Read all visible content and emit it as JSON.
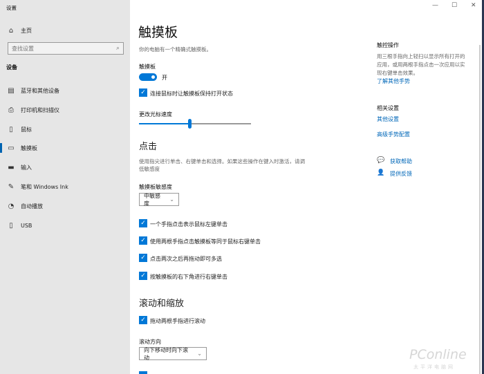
{
  "window": {
    "title": "设置",
    "minimize": "—",
    "maximize": "☐",
    "close": "✕"
  },
  "sidebar": {
    "home": "主页",
    "search_placeholder": "查找设置",
    "section": "设备",
    "items": [
      {
        "label": "蓝牙和其他设备",
        "icon": "bluetooth-devices-icon"
      },
      {
        "label": "打印机和扫描仪",
        "icon": "printer-icon"
      },
      {
        "label": "鼠标",
        "icon": "mouse-icon"
      },
      {
        "label": "触摸板",
        "icon": "touchpad-icon",
        "selected": true
      },
      {
        "label": "输入",
        "icon": "keyboard-icon"
      },
      {
        "label": "笔和 Windows Ink",
        "icon": "pen-icon"
      },
      {
        "label": "自动播放",
        "icon": "autoplay-icon"
      },
      {
        "label": "USB",
        "icon": "usb-icon"
      }
    ]
  },
  "main": {
    "title": "触摸板",
    "subtitle": "你的电脑有一个精确式触摸板。",
    "touchpad_label": "触摸板",
    "toggle_state": "开",
    "keep_on": "连接鼠标时让触摸板保持打开状态",
    "speed_label": "更改光标速度",
    "speed_value": 0.45,
    "tap": {
      "heading": "点击",
      "desc1": "使用指尖进行单击、右键单击和选择。如果这些操作在键入时激活，请调",
      "desc2": "低敏感度",
      "sens_label": "触摸板敏感度",
      "sens_value": "中敏感度",
      "options": [
        "一个手指点击表示鼠标左键单击",
        "使用两根手指点击触摸板等同于鼠标右键单击",
        "点击两次之后再拖动即可多选",
        "按触摸板的右下角进行右键单击"
      ]
    },
    "scroll": {
      "heading": "滚动和缩放",
      "drag_two": "拖动两根手指进行滚动",
      "dir_label": "滚动方向",
      "dir_value": "向下移动时向下滚动"
    }
  },
  "right": {
    "gesture_title": "触控操作",
    "gesture_l1": "用三根手指向上轻扫以显示所有打开的",
    "gesture_l2": "应用，或用两根手指点击一次应用以实",
    "gesture_l3": "现右键单击效果。",
    "learn": "了解其他手势",
    "related": "相关设置",
    "other": "其他设置",
    "advanced": "高级手势配置",
    "help": "获取帮助",
    "feedback": "提供反馈"
  },
  "watermark": {
    "brand": "PConline",
    "cn": "太平洋电脑网"
  },
  "colors": {
    "accent": "#0078d7",
    "sidebar": "#e6e6e6"
  }
}
